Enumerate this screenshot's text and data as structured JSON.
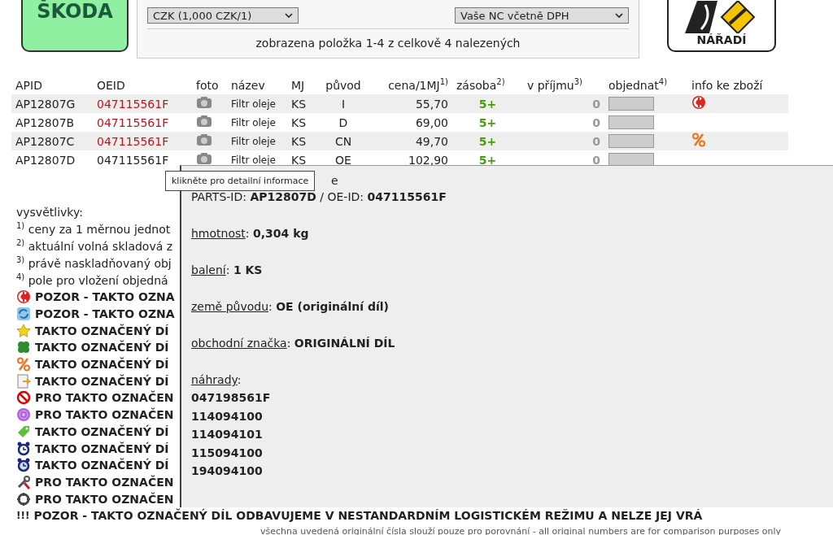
{
  "header": {
    "logo": "ŠKODA",
    "currency_select": "CZK (1,000 CZK/1)",
    "price_select": "Vaše NC včetně DPH",
    "result_text": "zobrazena položka 1-4 z celkově 4 nalezených",
    "tools_logo": "NÁŘADÍ"
  },
  "table": {
    "columns": [
      "APID",
      "OEID",
      "foto",
      "název",
      "MJ",
      "původ",
      "cena/1MJ$^{1)}$",
      "zásoba$^{2)}$",
      "v příjmu$^{3)}$",
      "objednat$^{4)}$",
      "info ke zboží"
    ],
    "rows": [
      {
        "apid": "AP12807G",
        "oeid": "047115561F",
        "oeid_highlighted": true,
        "name": "Filtr oleje",
        "unit": "KS",
        "origin": "I",
        "price": "55,70",
        "stock": "5+",
        "incoming": "0",
        "info": {
          "kind": "clearance"
        }
      },
      {
        "apid": "AP12807B",
        "oeid": "047115561F",
        "oeid_highlighted": true,
        "name": "Filtr oleje",
        "unit": "KS",
        "origin": "D",
        "price": "69,00",
        "stock": "5+",
        "incoming": "0"
      },
      {
        "apid": "AP12807C",
        "oeid": "047115561F",
        "oeid_highlighted": true,
        "name": "Filtr oleje",
        "unit": "KS",
        "origin": "CN",
        "price": "49,70",
        "stock": "5+",
        "incoming": "0",
        "info": {
          "kind": "percent"
        }
      },
      {
        "apid": "AP12807D",
        "oeid": "047115561F",
        "oeid_highlighted": false,
        "name": "Filtr oleje",
        "unit": "KS",
        "origin": "OE",
        "price": "102,90",
        "stock": "5+",
        "incoming": "0"
      }
    ]
  },
  "legend": {
    "title": "vysvětlivky:",
    "notes": [
      {
        "mark": "1)",
        "text": "ceny za 1 měrnou jednot"
      },
      {
        "mark": "2)",
        "text": "aktuální volná skladová z"
      },
      {
        "mark": "3)",
        "text": "právě naskladňovaný obj"
      },
      {
        "mark": "4)",
        "text": "pole pro vložení objedná"
      }
    ],
    "items": [
      {
        "kind": "clearance",
        "text": "POZOR - TAKTO OZNA"
      },
      {
        "kind": "refresh",
        "text": "POZOR - TAKTO OZNA"
      },
      {
        "kind": "star",
        "text": "TAKTO OZNAČENÝ DÍ"
      },
      {
        "kind": "clover",
        "text": "TAKTO OZNAČENÝ DÍ"
      },
      {
        "kind": "percent",
        "text": "TAKTO OZNAČENÝ DÍ"
      },
      {
        "kind": "note",
        "text": "TAKTO OZNAČENÝ DÍ"
      },
      {
        "kind": "prohibited",
        "text": "PRO TAKTO OZNAČEN"
      },
      {
        "kind": "target",
        "text": "PRO TAKTO OZNAČEN"
      },
      {
        "kind": "tag",
        "text": "TAKTO OZNAČENÝ DÍ"
      },
      {
        "kind": "alarm",
        "text": "TAKTO OZNAČENÝ DÍ"
      },
      {
        "kind": "alarm_blue",
        "text": "TAKTO OZNAČENÝ DÍ"
      },
      {
        "kind": "tools",
        "text": "PRO TAKTO OZNAČEN"
      },
      {
        "kind": "ring",
        "text": "PRO TAKTO OZNAČEN"
      },
      {
        "kind": "text_marker",
        "marker": "!!!",
        "text": "POZOR - TAKTO OZNAČENÝ DÍL ODBAVUJEME V NESTANDARDNÍM LOGISTICKÉM REŽIMU A NELZE JEJ VRÁ"
      }
    ]
  },
  "detail_popup": {
    "title_fragment": "e",
    "id_line": "PARTS-ID: **AP12807D** / OE-ID: **047115561F**",
    "fields": [
      {
        "label": "hmotnost",
        "value": ": **0,304 kg**"
      },
      {
        "label": "balení",
        "value": ": **1 KS**"
      },
      {
        "label": "země původu",
        "value": ": **OE (originální díl)**"
      },
      {
        "label": "obchodní značka",
        "value": ": **ORIGINÁLNÍ DÍL**"
      }
    ],
    "alternatives_label": "náhrady",
    "alternatives_colon": ":",
    "alternatives": [
      "047198561F",
      "114094100",
      "114094101",
      "115094100",
      "194094100"
    ]
  },
  "tooltip": "klikněte pro detailní informace",
  "footer": "všechna uvedená originální čísla slouží pouze pro porovnání - all original numbers are for comparison purposes only"
}
